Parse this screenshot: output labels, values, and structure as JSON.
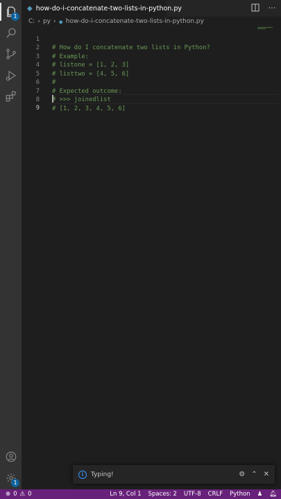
{
  "tab": {
    "filename": "how-do-i-concatenate-two-lists-in-python.py"
  },
  "breadcrumb": {
    "root": "C:",
    "folder": "py",
    "file": "how-do-i-concatenate-two-lists-in-python.py"
  },
  "activity_bar": {
    "explorer_badge": "1",
    "accounts_badge": "1"
  },
  "editor": {
    "lines": [
      {
        "num": "1",
        "text": "# How do I concatenate two lists in Python?"
      },
      {
        "num": "2",
        "text": "# Example:"
      },
      {
        "num": "3",
        "text": "# listone = [1, 2, 3]"
      },
      {
        "num": "4",
        "text": "# listtwo = [4, 5, 6]"
      },
      {
        "num": "5",
        "text": "#"
      },
      {
        "num": "6",
        "text": "# Expected outcome:"
      },
      {
        "num": "7",
        "text": "# >>> joinedlist"
      },
      {
        "num": "8",
        "text": "# [1, 2, 3, 4, 5, 6]"
      },
      {
        "num": "9",
        "text": ""
      }
    ]
  },
  "notification": {
    "message": "Typing!"
  },
  "status_bar": {
    "errors": "0",
    "warnings": "0",
    "position": "Ln 9, Col 1",
    "spaces": "Spaces: 2",
    "encoding": "UTF-8",
    "eol": "CRLF",
    "language": "Python"
  },
  "colors": {
    "status_bar": "#68217a",
    "comment": "#6a9955",
    "editor_bg": "#1e1e1e"
  }
}
